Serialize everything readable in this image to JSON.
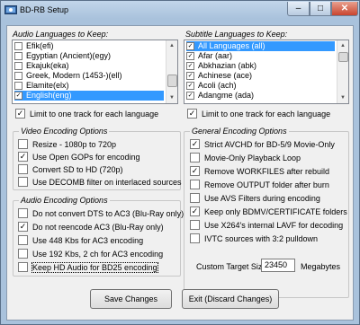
{
  "window": {
    "title": "BD-RB Setup",
    "icon_name": "app-icon",
    "minimize_glyph": "–",
    "maximize_glyph": "□",
    "close_glyph": "✕"
  },
  "audio": {
    "heading": "Audio Languages to Keep:",
    "items": [
      {
        "label": "Efik(efi)",
        "checked": false
      },
      {
        "label": "Egyptian (Ancient)(egy)",
        "checked": false
      },
      {
        "label": "Ekajuk(eka)",
        "checked": false
      },
      {
        "label": "Greek, Modern (1453-)(ell)",
        "checked": false
      },
      {
        "label": "Elamite(elx)",
        "checked": false
      },
      {
        "label": "English(eng)",
        "checked": true,
        "selected": true
      }
    ],
    "limit_label": "Limit to one track for each language",
    "limit_checked": true
  },
  "subtitle": {
    "heading": "Subtitle Languages to Keep:",
    "items": [
      {
        "label": "All Languages (all)",
        "checked": true,
        "selected": true
      },
      {
        "label": "Afar (aar)",
        "checked": true
      },
      {
        "label": "Abkhazian (abk)",
        "checked": true
      },
      {
        "label": "Achinese (ace)",
        "checked": true
      },
      {
        "label": "Acoli (ach)",
        "checked": true
      },
      {
        "label": "Adangme (ada)",
        "checked": true
      }
    ],
    "limit_label": "Limit to one track for each language",
    "limit_checked": true
  },
  "video_encoding": {
    "title": "Video Encoding Options",
    "options": [
      {
        "label": "Resize  - 1080p to 720p",
        "checked": false
      },
      {
        "label": "Use Open GOPs for encoding",
        "checked": true
      },
      {
        "label": "Convert SD to HD (720p)",
        "checked": false
      },
      {
        "label": "Use DECOMB filter on interlaced sources",
        "checked": false
      }
    ]
  },
  "audio_encoding": {
    "title": "Audio Encoding Options",
    "options": [
      {
        "label": "Do not convert DTS to AC3  (Blu-Ray only)",
        "checked": false
      },
      {
        "label": "Do not reencode AC3  (Blu-Ray only)",
        "checked": true
      },
      {
        "label": "Use 448 Kbs for AC3 encoding",
        "checked": false
      },
      {
        "label": "Use 192 Kbs, 2 ch for AC3 encoding",
        "checked": false
      },
      {
        "label": "Keep HD Audio for BD25 encoding",
        "checked": false
      }
    ]
  },
  "general_encoding": {
    "title": "General Encoding Options",
    "options": [
      {
        "label": "Strict AVCHD for BD-5/9 Movie-Only",
        "checked": true
      },
      {
        "label": "Movie-Only Playback Loop",
        "checked": false
      },
      {
        "label": "Remove WORKFILES after rebuild",
        "checked": true
      },
      {
        "label": "Remove OUTPUT folder after burn",
        "checked": false
      },
      {
        "label": "Use AVS Filters during encoding",
        "checked": false
      },
      {
        "label": "Keep only BDMV/CERTIFICATE folders",
        "checked": true
      },
      {
        "label": "Use X264's internal LAVF for decoding",
        "checked": false
      },
      {
        "label": "IVTC sources with 3:2 pulldown",
        "checked": false
      }
    ],
    "target_size_label": "Custom Target Size :",
    "target_size_value": "23450",
    "target_size_unit": "Megabytes"
  },
  "buttons": {
    "save": "Save Changes",
    "exit": "Exit (Discard Changes)"
  },
  "check_glyph": "✓",
  "colors": {
    "selection": "#3399ff",
    "window_frame": "#a9c2dc",
    "close_button": "#c9442e"
  }
}
